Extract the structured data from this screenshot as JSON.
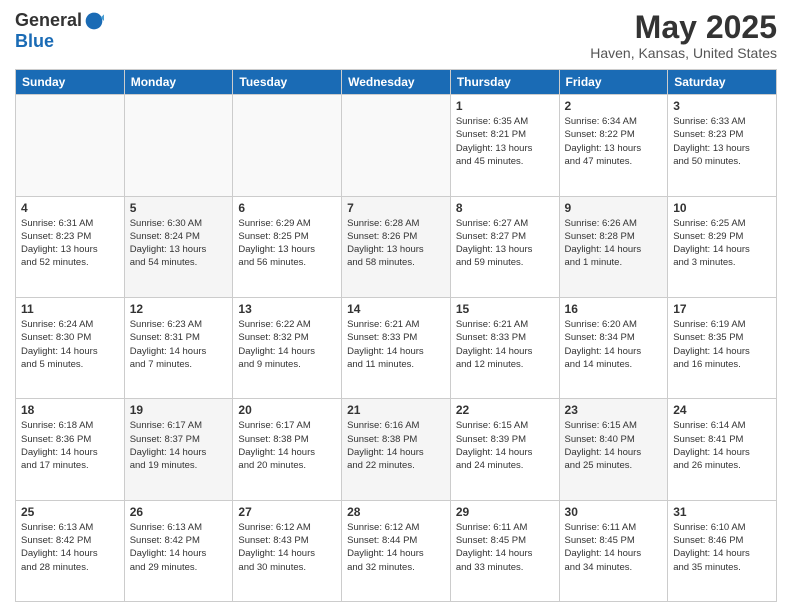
{
  "logo": {
    "general": "General",
    "blue": "Blue"
  },
  "title": "May 2025",
  "location": "Haven, Kansas, United States",
  "days_of_week": [
    "Sunday",
    "Monday",
    "Tuesday",
    "Wednesday",
    "Thursday",
    "Friday",
    "Saturday"
  ],
  "weeks": [
    [
      {
        "day": "",
        "info": ""
      },
      {
        "day": "",
        "info": ""
      },
      {
        "day": "",
        "info": ""
      },
      {
        "day": "",
        "info": ""
      },
      {
        "day": "1",
        "info": "Sunrise: 6:35 AM\nSunset: 8:21 PM\nDaylight: 13 hours\nand 45 minutes."
      },
      {
        "day": "2",
        "info": "Sunrise: 6:34 AM\nSunset: 8:22 PM\nDaylight: 13 hours\nand 47 minutes."
      },
      {
        "day": "3",
        "info": "Sunrise: 6:33 AM\nSunset: 8:23 PM\nDaylight: 13 hours\nand 50 minutes."
      }
    ],
    [
      {
        "day": "4",
        "info": "Sunrise: 6:31 AM\nSunset: 8:23 PM\nDaylight: 13 hours\nand 52 minutes."
      },
      {
        "day": "5",
        "info": "Sunrise: 6:30 AM\nSunset: 8:24 PM\nDaylight: 13 hours\nand 54 minutes."
      },
      {
        "day": "6",
        "info": "Sunrise: 6:29 AM\nSunset: 8:25 PM\nDaylight: 13 hours\nand 56 minutes."
      },
      {
        "day": "7",
        "info": "Sunrise: 6:28 AM\nSunset: 8:26 PM\nDaylight: 13 hours\nand 58 minutes."
      },
      {
        "day": "8",
        "info": "Sunrise: 6:27 AM\nSunset: 8:27 PM\nDaylight: 13 hours\nand 59 minutes."
      },
      {
        "day": "9",
        "info": "Sunrise: 6:26 AM\nSunset: 8:28 PM\nDaylight: 14 hours\nand 1 minute."
      },
      {
        "day": "10",
        "info": "Sunrise: 6:25 AM\nSunset: 8:29 PM\nDaylight: 14 hours\nand 3 minutes."
      }
    ],
    [
      {
        "day": "11",
        "info": "Sunrise: 6:24 AM\nSunset: 8:30 PM\nDaylight: 14 hours\nand 5 minutes."
      },
      {
        "day": "12",
        "info": "Sunrise: 6:23 AM\nSunset: 8:31 PM\nDaylight: 14 hours\nand 7 minutes."
      },
      {
        "day": "13",
        "info": "Sunrise: 6:22 AM\nSunset: 8:32 PM\nDaylight: 14 hours\nand 9 minutes."
      },
      {
        "day": "14",
        "info": "Sunrise: 6:21 AM\nSunset: 8:33 PM\nDaylight: 14 hours\nand 11 minutes."
      },
      {
        "day": "15",
        "info": "Sunrise: 6:21 AM\nSunset: 8:33 PM\nDaylight: 14 hours\nand 12 minutes."
      },
      {
        "day": "16",
        "info": "Sunrise: 6:20 AM\nSunset: 8:34 PM\nDaylight: 14 hours\nand 14 minutes."
      },
      {
        "day": "17",
        "info": "Sunrise: 6:19 AM\nSunset: 8:35 PM\nDaylight: 14 hours\nand 16 minutes."
      }
    ],
    [
      {
        "day": "18",
        "info": "Sunrise: 6:18 AM\nSunset: 8:36 PM\nDaylight: 14 hours\nand 17 minutes."
      },
      {
        "day": "19",
        "info": "Sunrise: 6:17 AM\nSunset: 8:37 PM\nDaylight: 14 hours\nand 19 minutes."
      },
      {
        "day": "20",
        "info": "Sunrise: 6:17 AM\nSunset: 8:38 PM\nDaylight: 14 hours\nand 20 minutes."
      },
      {
        "day": "21",
        "info": "Sunrise: 6:16 AM\nSunset: 8:38 PM\nDaylight: 14 hours\nand 22 minutes."
      },
      {
        "day": "22",
        "info": "Sunrise: 6:15 AM\nSunset: 8:39 PM\nDaylight: 14 hours\nand 24 minutes."
      },
      {
        "day": "23",
        "info": "Sunrise: 6:15 AM\nSunset: 8:40 PM\nDaylight: 14 hours\nand 25 minutes."
      },
      {
        "day": "24",
        "info": "Sunrise: 6:14 AM\nSunset: 8:41 PM\nDaylight: 14 hours\nand 26 minutes."
      }
    ],
    [
      {
        "day": "25",
        "info": "Sunrise: 6:13 AM\nSunset: 8:42 PM\nDaylight: 14 hours\nand 28 minutes."
      },
      {
        "day": "26",
        "info": "Sunrise: 6:13 AM\nSunset: 8:42 PM\nDaylight: 14 hours\nand 29 minutes."
      },
      {
        "day": "27",
        "info": "Sunrise: 6:12 AM\nSunset: 8:43 PM\nDaylight: 14 hours\nand 30 minutes."
      },
      {
        "day": "28",
        "info": "Sunrise: 6:12 AM\nSunset: 8:44 PM\nDaylight: 14 hours\nand 32 minutes."
      },
      {
        "day": "29",
        "info": "Sunrise: 6:11 AM\nSunset: 8:45 PM\nDaylight: 14 hours\nand 33 minutes."
      },
      {
        "day": "30",
        "info": "Sunrise: 6:11 AM\nSunset: 8:45 PM\nDaylight: 14 hours\nand 34 minutes."
      },
      {
        "day": "31",
        "info": "Sunrise: 6:10 AM\nSunset: 8:46 PM\nDaylight: 14 hours\nand 35 minutes."
      }
    ]
  ]
}
